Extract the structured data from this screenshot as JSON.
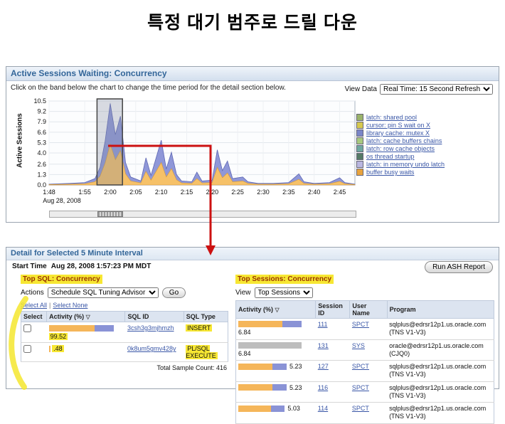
{
  "page_title": "특정 대기 범주로 드릴 다운",
  "panel": {
    "header": "Active Sessions Waiting: Concurrency",
    "instruction": "Click on the band below the chart to change the time period for the detail section below.",
    "view_data_label": "View Data",
    "view_data_value": "Real Time: 15 Second Refresh"
  },
  "chart_data": {
    "type": "area",
    "title": "Active Sessions Waiting: Concurrency",
    "ylabel": "Active Sessions",
    "ylim": [
      0,
      10.5
    ],
    "yticks": [
      0,
      1.3,
      2.6,
      4.0,
      5.3,
      6.6,
      7.9,
      9.2,
      10.5
    ],
    "xticks": [
      {
        "minute": 0,
        "label": "1:48"
      },
      {
        "minute": 7,
        "label": "1:55"
      },
      {
        "minute": 12,
        "label": "2:00"
      },
      {
        "minute": 17,
        "label": "2:05"
      },
      {
        "minute": 22,
        "label": "2:10"
      },
      {
        "minute": 27,
        "label": "2:15"
      },
      {
        "minute": 32,
        "label": "2:20"
      },
      {
        "minute": 37,
        "label": "2:25"
      },
      {
        "minute": 42,
        "label": "2:30"
      },
      {
        "minute": 47,
        "label": "2:35"
      },
      {
        "minute": 52,
        "label": "2:40"
      },
      {
        "minute": 57,
        "label": "2:45"
      }
    ],
    "x_axis_date": "Aug 28, 2008",
    "x_minutes": [
      0,
      4,
      7,
      9,
      10,
      11,
      12,
      13,
      14,
      15,
      16,
      18,
      19,
      20,
      22,
      23,
      24,
      25,
      26,
      28,
      29,
      30,
      32,
      33,
      34,
      35,
      36,
      38,
      39,
      41,
      44,
      47,
      49,
      50,
      52,
      55,
      57,
      58,
      60
    ],
    "values": [
      0.1,
      0.2,
      0.3,
      0.8,
      2.2,
      5.5,
      10.2,
      6.3,
      8.6,
      2.8,
      1.0,
      0.5,
      3.4,
      1.2,
      5.6,
      2.0,
      4.1,
      1.3,
      0.5,
      0.4,
      1.6,
      0.5,
      0.6,
      4.4,
      1.8,
      3.0,
      0.8,
      1.0,
      0.4,
      0.2,
      0.2,
      0.3,
      1.4,
      0.4,
      0.2,
      0.3,
      0.9,
      0.3,
      0.1
    ],
    "selection": {
      "start_minute": 9.4,
      "end_minute": 14.4
    },
    "colors": {
      "area_top": "#8f97d8",
      "area_top_stroke": "#5f68b3",
      "area_bottom": "#f6c168",
      "area_bottom_stroke": "#d99b33",
      "selection_fill": "rgba(130,140,160,0.30)",
      "selection_stroke": "#444444"
    },
    "legend": [
      {
        "label": "latch: shared pool",
        "color": "#9ab36b"
      },
      {
        "label": "cursor: pin S wait on X",
        "color": "#d6c94f"
      },
      {
        "label": "library cache: mutex X",
        "color": "#7b86c8"
      },
      {
        "label": "latch: cache buffers chains",
        "color": "#a8c97f"
      },
      {
        "label": "latch: row cache objects",
        "color": "#6fa8a0"
      },
      {
        "label": "os thread startup",
        "color": "#557a66"
      },
      {
        "label": "latch: in memory undo latch",
        "color": "#b9b6e0"
      },
      {
        "label": "buffer busy waits",
        "color": "#e8a33d"
      }
    ]
  },
  "detail": {
    "header": "Detail for Selected 5 Minute Interval",
    "start_time_label": "Start Time",
    "start_time_value": "Aug 28, 2008 1:57:23 PM MDT",
    "run_ash_button": "Run ASH Report",
    "sort_icon": "▽",
    "top_sql": {
      "title": "Top SQL: Concurrency",
      "actions_label": "Actions",
      "actions_value": "Schedule SQL Tuning Advisor",
      "go_button": "Go",
      "select_all": "Select All",
      "select_none": "Select None",
      "columns": [
        "Select",
        "Activity (%)",
        "SQL ID",
        "SQL Type"
      ],
      "rows": [
        {
          "pct": 99.52,
          "activity": "99.52",
          "sql_id": "3csh3g3mjhmzh",
          "sql_type": "INSERT"
        },
        {
          "pct": 0.48,
          "activity": ".48",
          "sql_id": "0k8um5gmv428y",
          "sql_type": "PL/SQL EXECUTE"
        }
      ],
      "total": "Total Sample Count: 416"
    },
    "top_sessions": {
      "title": "Top Sessions: Concurrency",
      "view_label": "View",
      "view_value": "Top Sessions",
      "columns": [
        "Activity (%)",
        "Session ID",
        "User Name",
        "Program"
      ],
      "rows": [
        {
          "pct": 6.84,
          "activity": "6.84",
          "session_id": "111",
          "user_name": "SPCT",
          "program": "sqlplus@edrsr12p1.us.oracle.com (TNS V1-V3)"
        },
        {
          "pct": 6.84,
          "activity": "6.84",
          "session_id": "131",
          "user_name": "SYS",
          "program": "oracle@edrsr12p1.us.oracle.com (CJQ0)"
        },
        {
          "pct": 5.23,
          "activity": "5.23",
          "session_id": "127",
          "user_name": "SPCT",
          "program": "sqlplus@edrsr12p1.us.oracle.com (TNS V1-V3)"
        },
        {
          "pct": 5.23,
          "activity": "5.23",
          "session_id": "116",
          "user_name": "SPCT",
          "program": "sqlplus@edrsr12p1.us.oracle.com (TNS V1-V3)"
        },
        {
          "pct": 5.03,
          "activity": "5.03",
          "session_id": "114",
          "user_name": "SPCT",
          "program": "sqlplus@edrsr12p1.us.oracle.com (TNS V1-V3)"
        }
      ]
    }
  }
}
